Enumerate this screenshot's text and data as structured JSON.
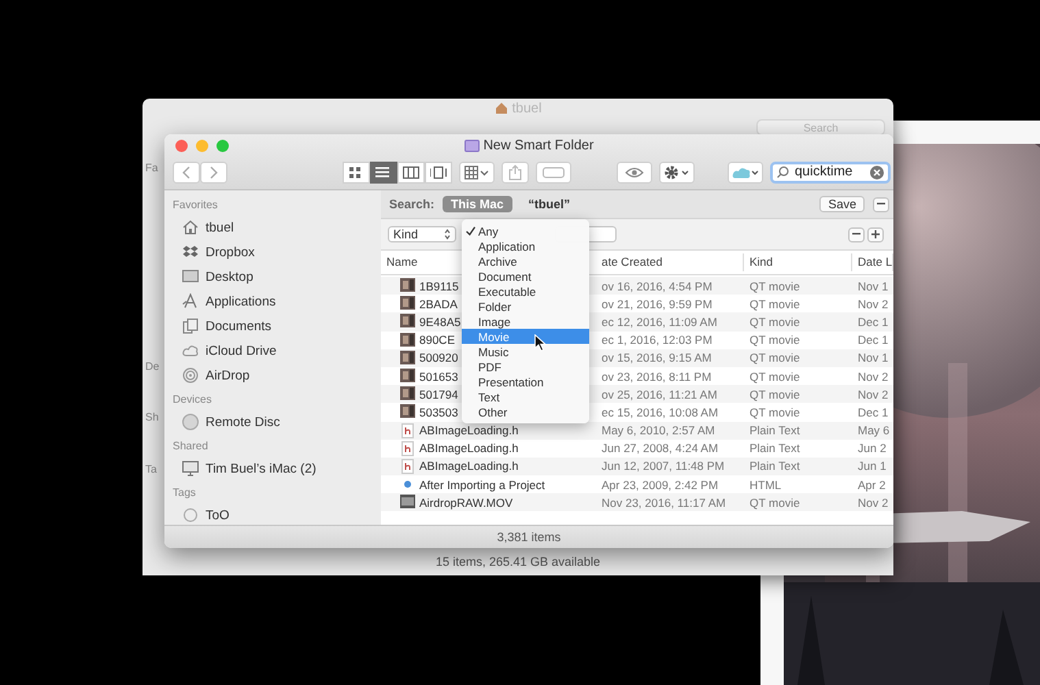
{
  "back_window": {
    "title": "tbuel",
    "search_placeholder": "Search",
    "sidebar_fragments": [
      "Fa",
      "De",
      "Sh",
      "Ta"
    ],
    "status": "15 items, 265.41 GB available"
  },
  "window": {
    "title": "New Smart Folder"
  },
  "toolbar": {
    "views": [
      {
        "kind": "icons",
        "selected": false
      },
      {
        "kind": "list",
        "selected": true
      },
      {
        "kind": "columns",
        "selected": false
      },
      {
        "kind": "cover",
        "selected": false
      }
    ],
    "search_value": "quicktime"
  },
  "sidebar": {
    "sections": [
      {
        "title": "Favorites",
        "items": [
          {
            "kind": "home",
            "label": "tbuel"
          },
          {
            "kind": "dropbox",
            "label": "Dropbox"
          },
          {
            "kind": "desktop",
            "label": "Desktop"
          },
          {
            "kind": "apps",
            "label": "Applications"
          },
          {
            "kind": "docs",
            "label": "Documents"
          },
          {
            "kind": "cloud",
            "label": "iCloud Drive"
          },
          {
            "kind": "airdrop",
            "label": "AirDrop"
          }
        ]
      },
      {
        "title": "Devices",
        "items": [
          {
            "kind": "disc",
            "label": "Remote Disc"
          }
        ]
      },
      {
        "title": "Shared",
        "items": [
          {
            "kind": "imac",
            "label": "Tim Buel’s iMac (2)"
          }
        ]
      },
      {
        "title": "Tags",
        "items": [
          {
            "kind": "tag",
            "label": "ToO"
          }
        ]
      }
    ]
  },
  "search_bar": {
    "label": "Search:",
    "scopes": [
      {
        "label": "This Mac",
        "selected": true
      },
      {
        "label": "“tbuel”",
        "selected": false
      }
    ],
    "save": "Save"
  },
  "criteria": {
    "attribute": "Kind"
  },
  "kind_menu": {
    "items": [
      {
        "label": "Any",
        "checked": true,
        "selected": false
      },
      {
        "label": "Application",
        "checked": false,
        "selected": false
      },
      {
        "label": "Archive",
        "checked": false,
        "selected": false
      },
      {
        "label": "Document",
        "checked": false,
        "selected": false
      },
      {
        "label": "Executable",
        "checked": false,
        "selected": false
      },
      {
        "label": "Folder",
        "checked": false,
        "selected": false
      },
      {
        "label": "Image",
        "checked": false,
        "selected": false
      },
      {
        "label": "Movie",
        "checked": false,
        "selected": true
      },
      {
        "label": "Music",
        "checked": false,
        "selected": false
      },
      {
        "label": "PDF",
        "checked": false,
        "selected": false
      },
      {
        "label": "Presentation",
        "checked": false,
        "selected": false
      },
      {
        "label": "Text",
        "checked": false,
        "selected": false
      },
      {
        "label": "Other",
        "checked": false,
        "selected": false
      }
    ]
  },
  "table": {
    "columns": [
      "Name",
      "ate Created",
      "Kind",
      "Date L"
    ],
    "rows": [
      {
        "kind": "thumb",
        "name": "1B9115",
        "date_created": "ov 16, 2016, 4:54 PM",
        "file_kind": "QT movie",
        "date_last": "Nov 1"
      },
      {
        "kind": "thumb",
        "name": "2BADA",
        "date_created": "ov 21, 2016, 9:59 PM",
        "file_kind": "QT movie",
        "date_last": "Nov 2"
      },
      {
        "kind": "thumb",
        "name": "9E48A5",
        "date_created": "ec 12, 2016, 11:09 AM",
        "file_kind": "QT movie",
        "date_last": "Dec 1"
      },
      {
        "kind": "thumb",
        "name": "890CE",
        "date_created": "ec 1, 2016, 12:03 PM",
        "file_kind": "QT movie",
        "date_last": "Dec 1"
      },
      {
        "kind": "thumb",
        "name": "500920",
        "date_created": "ov 15, 2016, 9:15 AM",
        "file_kind": "QT movie",
        "date_last": "Nov 1"
      },
      {
        "kind": "thumb",
        "name": "501653",
        "date_created": "ov 23, 2016, 8:11 PM",
        "file_kind": "QT movie",
        "date_last": "Nov 2"
      },
      {
        "kind": "thumb",
        "name": "501794",
        "date_created": "ov 25, 2016, 11:21 AM",
        "file_kind": "QT movie",
        "date_last": "Nov 2"
      },
      {
        "kind": "thumb",
        "name": "503503",
        "date_created": "ec 15, 2016, 10:08 AM",
        "file_kind": "QT movie",
        "date_last": "Dec 1"
      },
      {
        "kind": "header",
        "name": "ABImageLoading.h",
        "date_created": "May 6, 2010, 2:57 AM",
        "file_kind": "Plain Text",
        "date_last": "May 6"
      },
      {
        "kind": "header",
        "name": "ABImageLoading.h",
        "date_created": "Jun 27, 2008, 4:24 AM",
        "file_kind": "Plain Text",
        "date_last": "Jun 2"
      },
      {
        "kind": "header",
        "name": "ABImageLoading.h",
        "date_created": "Jun 12, 2007, 11:48 PM",
        "file_kind": "Plain Text",
        "date_last": "Jun 1"
      },
      {
        "kind": "html",
        "name": "After Importing a Project",
        "date_created": "Apr 23, 2009, 2:42 PM",
        "file_kind": "HTML",
        "date_last": "Apr 2"
      },
      {
        "kind": "movie",
        "name": "AirdropRAW.MOV",
        "date_created": "Nov 23, 2016, 11:17 AM",
        "file_kind": "QT movie",
        "date_last": "Nov 2"
      }
    ]
  },
  "status_bar": "3,381 items"
}
